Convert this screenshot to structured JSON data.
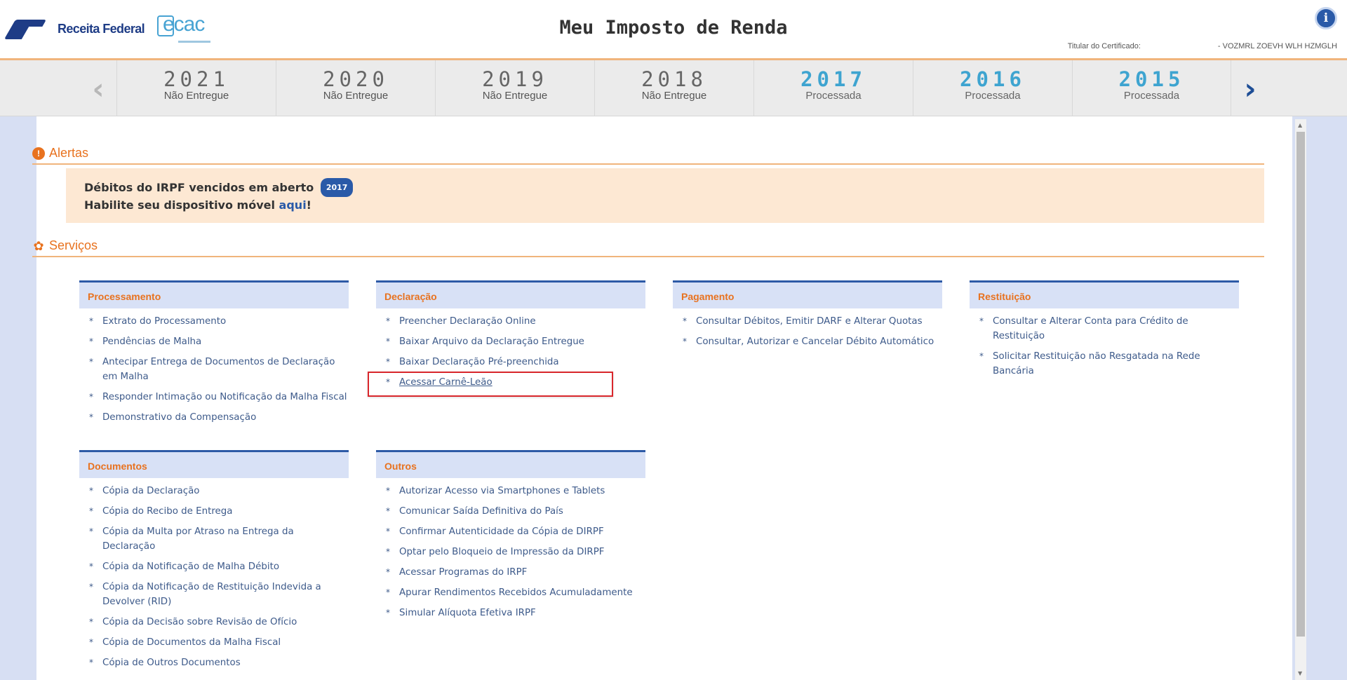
{
  "header": {
    "rf_name": "Receita Federal",
    "ecac_text": "ecac",
    "title": "Meu Imposto de Renda",
    "cert_label": "Titular do Certificado:",
    "cert_name": "- VOZMRL ZOEVH WLH HZMGLH",
    "info_label": "i"
  },
  "years": [
    {
      "year": "2021",
      "status": "Não Entregue"
    },
    {
      "year": "2020",
      "status": "Não Entregue"
    },
    {
      "year": "2019",
      "status": "Não Entregue"
    },
    {
      "year": "2018",
      "status": "Não Entregue"
    },
    {
      "year": "2017",
      "status": "Processada"
    },
    {
      "year": "2016",
      "status": "Processada"
    },
    {
      "year": "2015",
      "status": "Processada"
    }
  ],
  "nav": {
    "prev": "‹",
    "next": "›"
  },
  "alerts": {
    "title": "Alertas",
    "icon": "!",
    "line1": "Débitos do IRPF vencidos em aberto",
    "badge": "2017",
    "line2_prefix": "Habilite seu dispositivo móvel ",
    "line2_link": "aqui",
    "line2_suffix": "!"
  },
  "services": {
    "title": "Serviços",
    "icon": "✿"
  },
  "cards": {
    "processamento": {
      "title": "Processamento",
      "items": [
        "Extrato do Processamento",
        "Pendências de Malha",
        "Antecipar Entrega de Documentos de Declaração em Malha",
        "Responder Intimação ou Notificação da Malha Fiscal",
        "Demonstrativo da Compensação"
      ]
    },
    "declaracao": {
      "title": "Declaração",
      "items": [
        "Preencher Declaração Online",
        "Baixar Arquivo da Declaração Entregue",
        "Baixar Declaração Pré-preenchida",
        "Acessar Carnê-Leão"
      ]
    },
    "pagamento": {
      "title": "Pagamento",
      "items": [
        "Consultar Débitos, Emitir DARF e Alterar Quotas",
        "Consultar, Autorizar e Cancelar Débito Automático"
      ]
    },
    "restituicao": {
      "title": "Restituição",
      "items": [
        "Consultar e Alterar Conta para Crédito de Restituição",
        "Solicitar Restituição não Resgatada na Rede Bancária"
      ]
    },
    "documentos": {
      "title": "Documentos",
      "items": [
        "Cópia da Declaração",
        "Cópia do Recibo de Entrega",
        "Cópia da Multa por Atraso na Entrega da Declaração",
        "Cópia da Notificação de Malha Débito",
        "Cópia da Notificação de Restituição Indevida a Devolver (RID)",
        "Cópia da Decisão sobre Revisão de Ofício",
        "Cópia de Documentos da Malha Fiscal",
        "Cópia de Outros Documentos"
      ]
    },
    "outros": {
      "title": "Outros",
      "items": [
        "Autorizar Acesso via Smartphones e Tablets",
        "Comunicar Saída Definitiva do País",
        "Confirmar Autenticidade da Cópia de DIRPF",
        "Optar pelo Bloqueio de Impressão da DIRPF",
        "Acessar Programas do IRPF",
        "Apurar Rendimentos Recebidos Acumuladamente",
        "Simular Alíquota Efetiva IRPF"
      ]
    }
  }
}
